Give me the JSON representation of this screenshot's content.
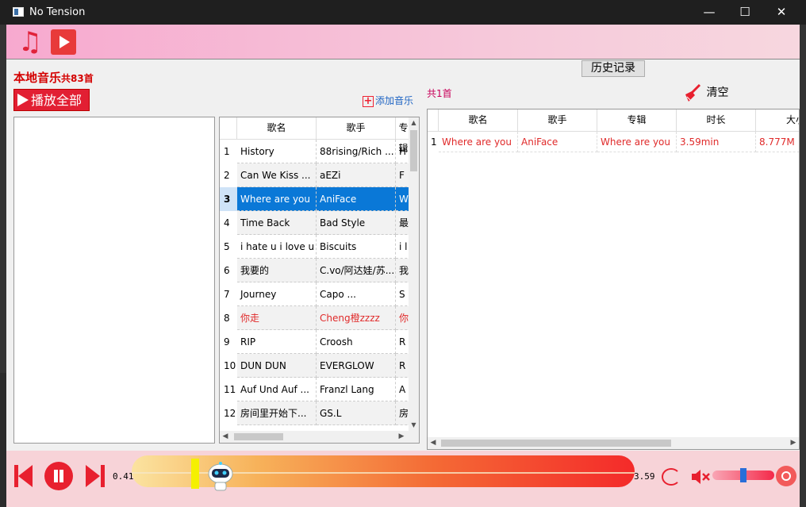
{
  "window": {
    "title": "No Tension",
    "minimize": "—",
    "maximize": "☐",
    "close": "✕"
  },
  "toolbar": {
    "music_icon": "music-note-icon",
    "video_icon": "video-play-icon"
  },
  "local": {
    "title": "本地音乐",
    "count": "共83首",
    "play_all": "播放全部",
    "add_music": "添加音乐"
  },
  "song_table": {
    "columns": [
      "歌名",
      "歌手",
      "专辑"
    ],
    "rows": [
      {
        "n": "1",
        "name": "History",
        "artist": "88rising/Rich ...",
        "album": "H"
      },
      {
        "n": "2",
        "name": "Can We Kiss ...",
        "artist": "aEZi",
        "album": "F"
      },
      {
        "n": "3",
        "name": "Where are you",
        "artist": "AniFace",
        "album": "W"
      },
      {
        "n": "4",
        "name": "Time Back",
        "artist": "Bad Style",
        "album": "最"
      },
      {
        "n": "5",
        "name": "i hate u i love u",
        "artist": "Biscuits",
        "album": "i l"
      },
      {
        "n": "6",
        "name": "我要的",
        "artist": "C.vo/阿达娃/苏...",
        "album": "我"
      },
      {
        "n": "7",
        "name": "Journey",
        "artist": "Capo ...",
        "album": "S"
      },
      {
        "n": "8",
        "name": "你走",
        "artist": "Cheng橙zzzz",
        "album": "你"
      },
      {
        "n": "9",
        "name": "RIP",
        "artist": "Croosh",
        "album": "R"
      },
      {
        "n": "10",
        "name": "DUN DUN",
        "artist": "EVERGLOW",
        "album": "R"
      },
      {
        "n": "11",
        "name": "Auf Und Auf ...",
        "artist": "Franzl Lang",
        "album": "A"
      },
      {
        "n": "12",
        "name": "房间里开始下...",
        "artist": "GS.L",
        "album": "房"
      }
    ],
    "selected_row": 3
  },
  "history": {
    "button": "历史记录",
    "count": "共1首",
    "clear": "清空",
    "columns": [
      "歌名",
      "歌手",
      "专辑",
      "时长",
      "大小"
    ],
    "rows": [
      {
        "n": "1",
        "name": "Where are you",
        "artist": "AniFace",
        "album": "Where are you",
        "duration": "3.59min",
        "size": "8.777M"
      }
    ]
  },
  "player": {
    "current_time": "0.41",
    "total_time": "3.59",
    "progress_fraction": 0.114,
    "volume_fraction": 0.5
  },
  "colors": {
    "accent": "#e8202f",
    "selection": "#0a78d7",
    "link": "#2166c4"
  }
}
